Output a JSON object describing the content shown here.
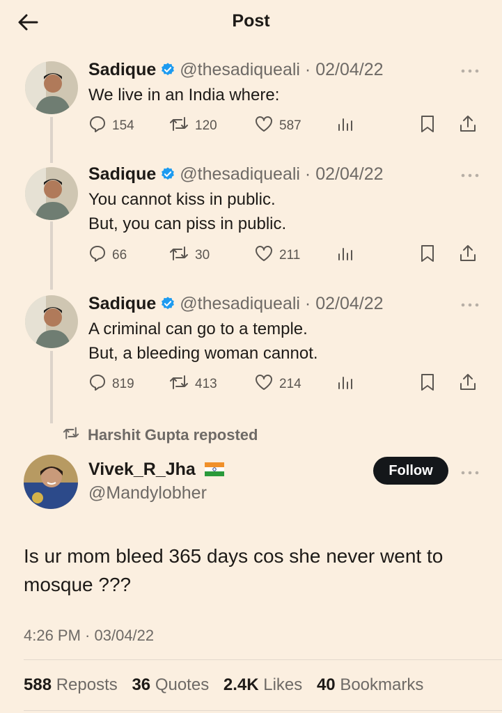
{
  "header": {
    "title": "Post"
  },
  "thread": [
    {
      "name": "Sadique",
      "handle": "@thesadiqueali",
      "date": "02/04/22",
      "text": [
        "We live in an India where:"
      ],
      "replies": "154",
      "reposts": "120",
      "likes": "587"
    },
    {
      "name": "Sadique",
      "handle": "@thesadiqueali",
      "date": "02/04/22",
      "text": [
        "You cannot kiss in public.",
        "But, you can piss in public."
      ],
      "replies": "66",
      "reposts": "30",
      "likes": "211"
    },
    {
      "name": "Sadique",
      "handle": "@thesadiqueali",
      "date": "02/04/22",
      "text": [
        "A criminal can go to a temple.",
        "But, a bleeding woman cannot."
      ],
      "replies": "819",
      "reposts": "413",
      "likes": "214"
    }
  ],
  "repost_note": "Harshit Gupta reposted",
  "main_post": {
    "name": "Vivek_R_Jha",
    "flag": "india-flag-icon",
    "handle": "@Mandylobher",
    "follow_label": "Follow",
    "text": [
      "Is ur mom bleed 365 days cos she never went to",
      "mosque ???"
    ],
    "time": "4:26 PM",
    "date": "03/04/22"
  },
  "stats": [
    {
      "value": "588",
      "label": "Reposts"
    },
    {
      "value": "36",
      "label": "Quotes"
    },
    {
      "value": "2.4K",
      "label": "Likes"
    },
    {
      "value": "40",
      "label": "Bookmarks"
    }
  ],
  "colors": {
    "background": "#fbefe0",
    "verified": "#1d9bf0",
    "follow_button": "#14171a",
    "muted_text": "#6e6a66"
  }
}
